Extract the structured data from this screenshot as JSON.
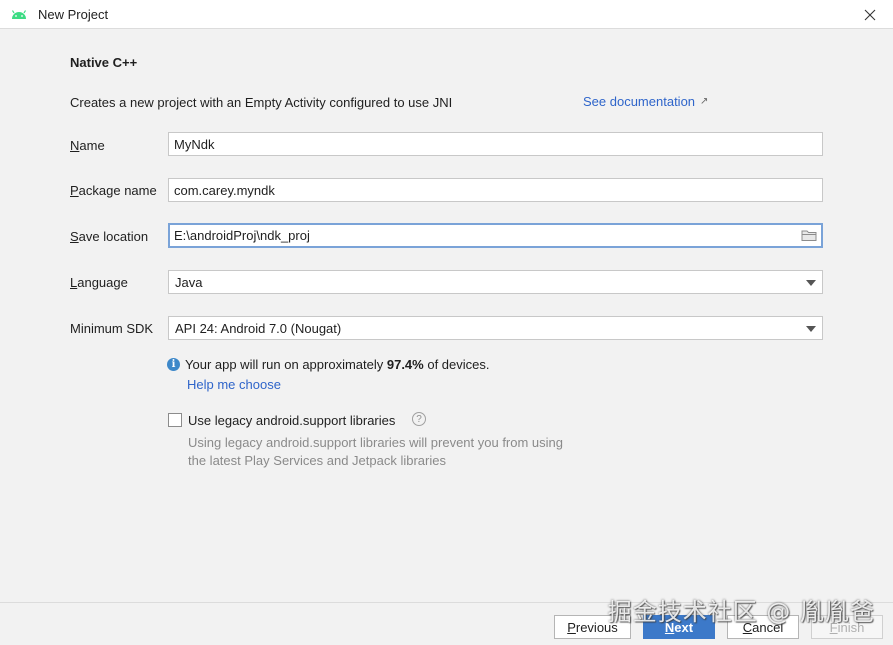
{
  "window": {
    "title": "New Project",
    "app_icon": "android-icon",
    "close_icon": "close-icon"
  },
  "main": {
    "heading": "Native C++",
    "description": "Creates a new project with an Empty Activity configured to use JNI",
    "doc_link": "See documentation",
    "doc_link_icon": "external-link-arrow-icon"
  },
  "form": {
    "name": {
      "label_mnemonic": "N",
      "label_rest": "ame",
      "value": "MyNdk"
    },
    "package": {
      "label_mnemonic": "P",
      "label_rest": "ackage name",
      "value": "com.carey.myndk"
    },
    "save_location": {
      "label_mnemonic": "S",
      "label_rest": "ave location",
      "value": "E:\\androidProj\\ndk_proj",
      "icon": "folder-icon"
    },
    "language": {
      "label_mnemonic": "L",
      "label_rest": "anguage",
      "value": "Java"
    },
    "min_sdk": {
      "label": "Minimum SDK",
      "value": "API 24: Android 7.0 (Nougat)"
    }
  },
  "info": {
    "icon": "info-icon",
    "text_before": "Your app will run on approximately ",
    "percent": "97.4%",
    "text_after": " of devices.",
    "help_link": "Help me choose"
  },
  "legacy": {
    "checked": false,
    "label": "Use legacy android.support libraries",
    "help_icon": "question-icon",
    "help_glyph": "?",
    "desc_line1": "Using legacy android.support libraries will prevent you from using",
    "desc_line2": "the latest Play Services and Jetpack libraries"
  },
  "footer": {
    "previous": {
      "mnemonic": "P",
      "rest": "revious"
    },
    "next": {
      "mnemonic": "N",
      "rest": "ext"
    },
    "cancel": {
      "mnemonic": "C",
      "rest": "ancel"
    },
    "finish": {
      "mnemonic": "F",
      "rest": "inish"
    }
  },
  "watermark": "掘金技术社区 @ 胤胤爸",
  "colors": {
    "accent": "#3c79c9",
    "link": "#2f65ca",
    "android_green": "#3ddc84",
    "focus_border": "#7aa3d8"
  }
}
